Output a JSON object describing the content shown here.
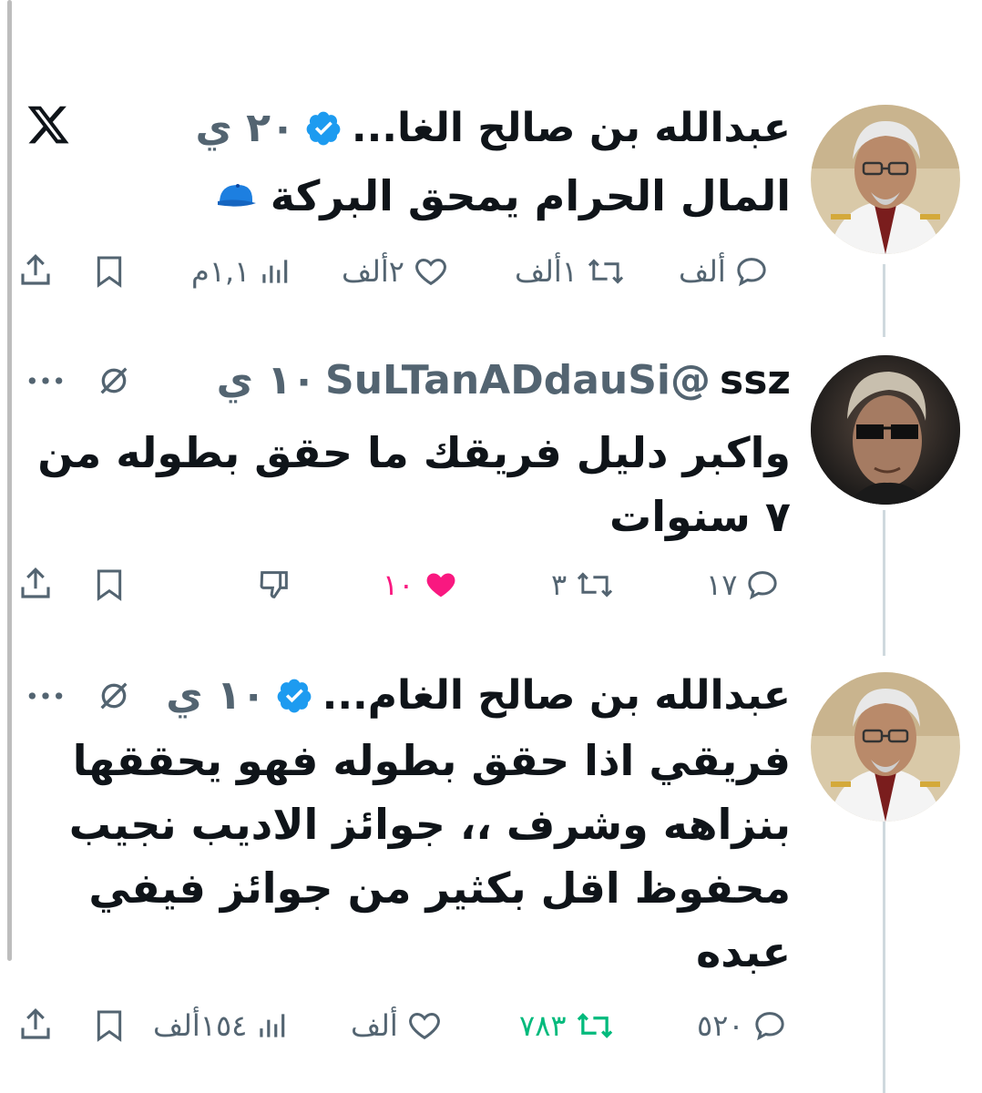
{
  "tweets": [
    {
      "name": "عبدالله بن صالح الغا...",
      "time": "٢٠ ي",
      "text": "المال الحرام يمحق البركة",
      "cap_emoji": "blue-cap-icon",
      "top_right_icon": "x-logo-icon",
      "replies": "ألف",
      "retweets": "١ألف",
      "likes": "٢ألف",
      "views": "١,١م"
    },
    {
      "name": "ssz",
      "handle": "@SuLTanADdauSi",
      "time": "١٠ ي",
      "text": "واكبر دليل فريقك ما حقق بطوله من ٧ سنوات",
      "replies": "١٧",
      "retweets": "٣",
      "likes": "١٠"
    },
    {
      "name": "عبدالله بن صالح الغام...",
      "time": "١٠ ي",
      "text": "فريقي اذا حقق بطوله فهو يحققها بنزاهه وشرف ،، جوائز الاديب نجيب محفوظ اقل بكثير من جوائز فيفي عبده",
      "replies": "٥٢٠",
      "retweets": "٧٨٣",
      "likes": "ألف",
      "views": "١٥٤ألف"
    }
  ],
  "colors": {
    "text": "#0f1419",
    "muted": "#536471",
    "verified": "#1d9bf0",
    "like_active": "#f91880",
    "retweet_active": "#00ba7c",
    "thread_line": "#cfd9de"
  }
}
